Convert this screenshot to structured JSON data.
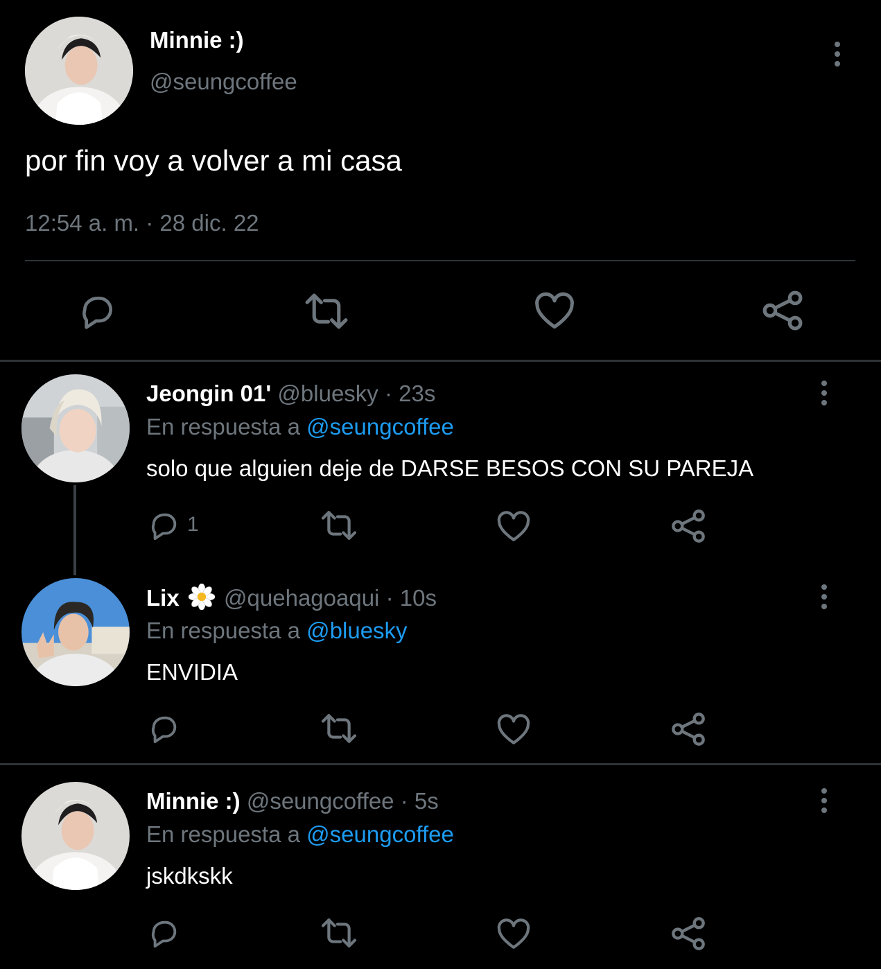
{
  "main_tweet": {
    "display_name": "Minnie :)",
    "handle": "@seungcoffee",
    "text": "por fin voy a volver a mi casa",
    "timestamp": "12:54 a. m. · 28 dic. 22"
  },
  "replies": [
    {
      "display_name": "Jeongin 01'",
      "handle": "@bluesky",
      "age": "· 23s",
      "reply_prefix": "En respuesta a",
      "reply_to": "@seungcoffee",
      "text": "solo que alguien deje de DARSE BESOS CON SU PAREJA",
      "reply_count": "1"
    },
    {
      "display_name": "Lix",
      "handle": "@quehagoaqui",
      "age": "· 10s",
      "reply_prefix": "En respuesta a",
      "reply_to": "@bluesky",
      "text": "ENVIDIA",
      "reply_count": ""
    },
    {
      "display_name": "Minnie :)",
      "handle": "@seungcoffee",
      "age": "· 5s",
      "reply_prefix": "En respuesta a",
      "reply_to": "@seungcoffee",
      "text": "jskdkskk",
      "reply_count": ""
    }
  ],
  "icons": {
    "reply": "comment-icon",
    "retweet": "retweet-icon",
    "like": "heart-icon",
    "share": "share-icon",
    "more": "more-vertical-icon",
    "flower": "daisy-emoji-icon"
  },
  "colors": {
    "background": "#000000",
    "text": "#ffffff",
    "muted": "#6e767d",
    "link": "#1d9bf0",
    "divider": "#2f3336"
  }
}
